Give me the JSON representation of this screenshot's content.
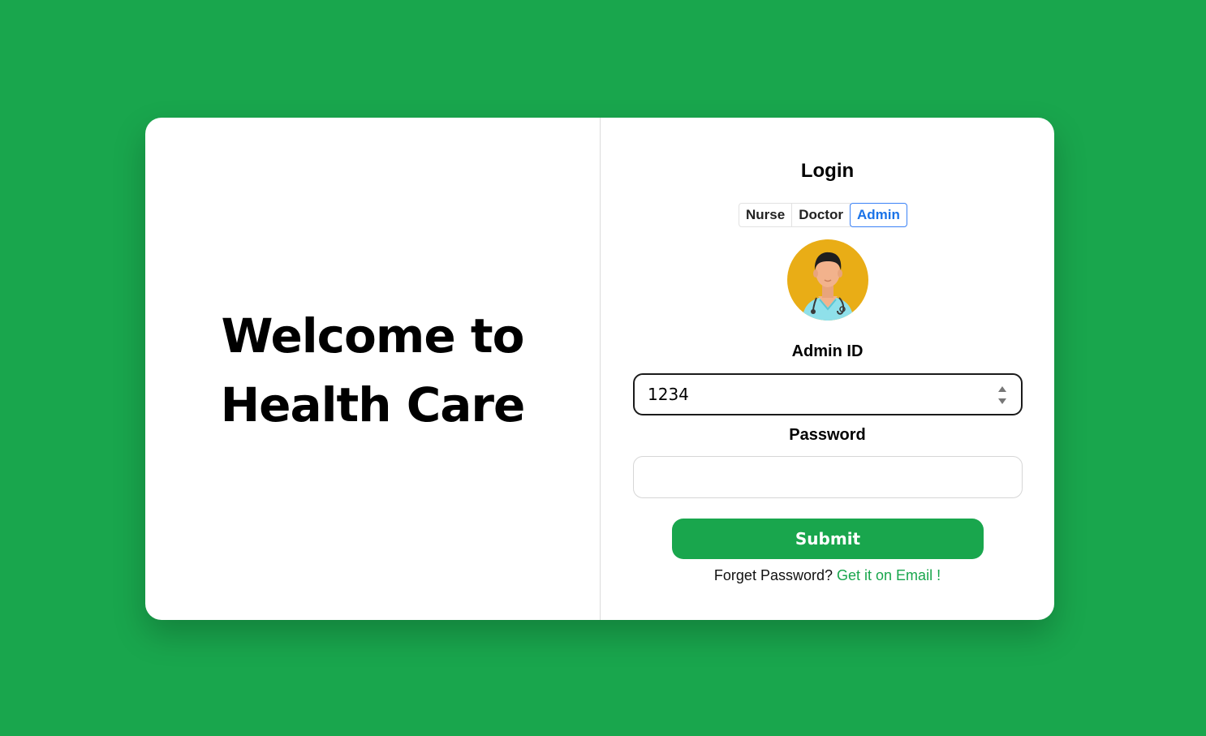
{
  "welcome": {
    "line1": "Welcome to",
    "line2": "Health Care"
  },
  "login": {
    "title": "Login",
    "tabs": [
      {
        "label": "Nurse",
        "active": false
      },
      {
        "label": "Doctor",
        "active": false
      },
      {
        "label": "Admin",
        "active": true
      }
    ],
    "avatar_icon": "doctor-avatar-icon",
    "id_label": "Admin ID",
    "id_value": "1234",
    "password_label": "Password",
    "password_value": "",
    "submit_label": "Submit",
    "forgot_text": "Forget Password?",
    "forgot_link": "Get it on Email !"
  },
  "colors": {
    "brand_green": "#19a64d",
    "active_tab_blue": "#1a73e8",
    "avatar_bg": "#e9ad16"
  }
}
